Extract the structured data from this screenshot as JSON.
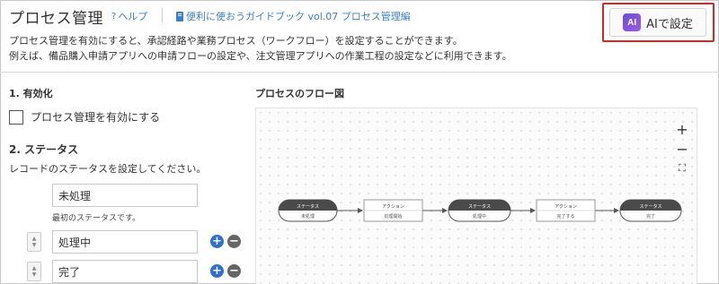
{
  "header": {
    "title": "プロセス管理",
    "help_icon": "?",
    "help_label": "ヘルプ",
    "guide_icon": "book-icon",
    "guide_label": "便利に使おうガイドブック vol.07 プロセス管理編",
    "ai_badge": "AI",
    "ai_button_label": "AIで設定"
  },
  "description": {
    "line1": "プロセス管理を有効にすると、承認経路や業務プロセス（ワークフロー）を設定することができます。",
    "line2": "例えば、備品購入申請アプリへの申請フローの設定や、注文管理アプリへの作業工程の設定などに利用できます。"
  },
  "section_enable": {
    "heading": "1. 有効化",
    "checkbox_label": "プロセス管理を有効にする",
    "checked": false
  },
  "section_status": {
    "heading": "2. ステータス",
    "description": "レコードのステータスを設定してください。",
    "initial_status": "未処理",
    "initial_note": "最初のステータスです。",
    "statuses": [
      "処理中",
      "完了"
    ]
  },
  "flow": {
    "title": "プロセスのフロー図",
    "nodes": [
      {
        "type": "ステータス",
        "label": "未処理"
      },
      {
        "type": "アクション",
        "label": "処理開始"
      },
      {
        "type": "ステータス",
        "label": "処理中"
      },
      {
        "type": "アクション",
        "label": "完了する"
      },
      {
        "type": "ステータス",
        "label": "完了"
      }
    ],
    "zoom_in": "+",
    "zoom_out": "−",
    "fit": "⛶"
  },
  "colors": {
    "highlight_border": "#e02424",
    "link": "#3c7fc4",
    "add_button": "#2f6fcf",
    "status_header": "#4a4a4a"
  }
}
